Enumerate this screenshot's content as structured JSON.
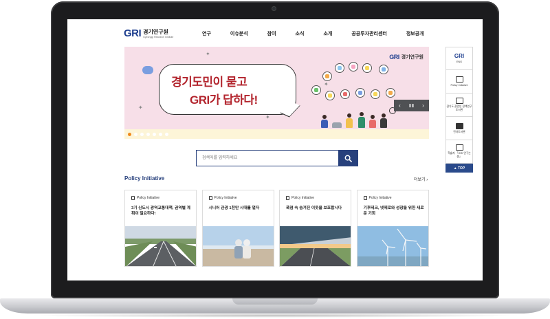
{
  "header": {
    "logo_mark": "GRI",
    "logo_kr": "경기연구원",
    "logo_en": "Gyeonggi Research Institute",
    "nav": [
      "연구",
      "이슈분석",
      "참여",
      "소식",
      "소개",
      "공공투자관리센터",
      "정보공개"
    ]
  },
  "banner": {
    "headline_line1": "경기도민이 묻고",
    "headline_line2": "GRI가 답하다!",
    "brand_mark": "GRI",
    "brand_text": "경기연구원",
    "slide_count": 7,
    "active_slide": 1,
    "controls": {
      "prev": "‹",
      "pause": "❚❚",
      "next": "›"
    },
    "colors": {
      "background": "#f7dfe8",
      "headline": "#b3252e",
      "strip": "#fdf5d8"
    }
  },
  "quick_menu": {
    "items": [
      {
        "label": "ENG",
        "icon": "gri-logo-icon"
      },
      {
        "label": "Policy Initiative",
        "icon": "document-chart-icon"
      },
      {
        "label": "경기도 관련인 정책연구 도서관",
        "icon": "library-icon"
      },
      {
        "label": "전자도서관",
        "icon": "book-icon"
      },
      {
        "label": "학술지 「GRI 연구논총」",
        "icon": "journal-icon"
      }
    ],
    "top_label": "▲ TOP"
  },
  "search": {
    "placeholder": "검색어를 입력하세요",
    "button_icon": "search-icon"
  },
  "policy": {
    "title": "Policy Initiative",
    "more": "더보기 ›",
    "cards": [
      {
        "tag": "Policy Initiative",
        "title": "3기 신도시 광역교통대책, 권역별 계획이 필요하다!",
        "image": "highway"
      },
      {
        "tag": "Policy Initiative",
        "title": "시니어 관광 1천만 시대를 열자",
        "image": "seniors-beach"
      },
      {
        "tag": "Policy Initiative",
        "title": "폭염 속 숨겨진 이웃을 보호합시다",
        "image": "solar-road"
      },
      {
        "tag": "Policy Initiative",
        "title": "기후테크, 넷제로와 성장을 위한 새로운 기회",
        "image": "wind-turbines"
      }
    ]
  },
  "colors": {
    "brand_navy": "#27407c",
    "brand_red": "#e8323c",
    "accent_orange": "#f08a1c"
  }
}
